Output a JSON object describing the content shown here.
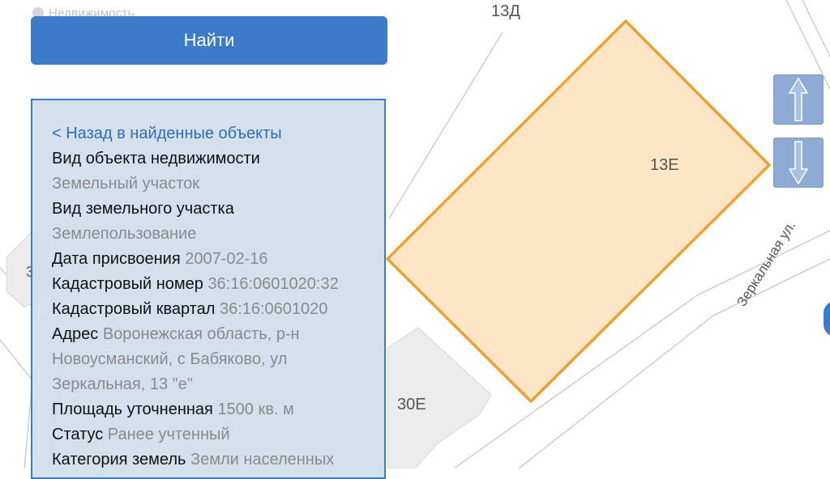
{
  "brand": "Недвижимость",
  "search_button": "Найти",
  "map": {
    "labels": {
      "top": "13Д",
      "parcel": "13Е",
      "building": "30Е",
      "left": "3",
      "street": "Зеркальная ул."
    },
    "colors": {
      "parcel_fill": "#fce2bb",
      "parcel_stroke": "#f0a030",
      "building_fill": "#ececec",
      "road": "#c9c9c9"
    }
  },
  "panel": {
    "back_link": "< Назад в найденные объекты",
    "object_type_label": "Вид объекта недвижимости",
    "object_type_value": "Земельный участок",
    "land_type_label": "Вид земельного участка",
    "land_type_value": "Землепользование",
    "assign_date_label": "Дата присвоения",
    "assign_date_value": "2007-02-16",
    "cadastral_number_label": "Кадастровый номер",
    "cadastral_number_value": "36:16:0601020:32",
    "cadastral_quarter_label": "Кадастровый квартал",
    "cadastral_quarter_value": "36:16:0601020",
    "address_label": "Адрес",
    "address_line1": "Воронежская область, р-н",
    "address_line2": "Новоусманский, с Бабяково, ул",
    "address_line3": "Зеркальная, 13 \"е\"",
    "area_label": "Площадь уточненная",
    "area_value": "1500 кв. м",
    "status_label": "Статус",
    "status_value": "Ранее учтенный",
    "category_label": "Категория земель",
    "category_value": "Земли населенных"
  },
  "controls": {
    "zoom_in_icon": "arrow-up-icon",
    "zoom_out_icon": "arrow-down-icon"
  }
}
